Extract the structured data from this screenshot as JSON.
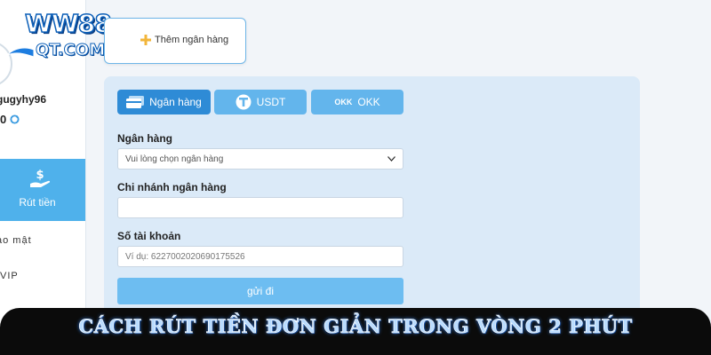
{
  "logo": {
    "line1": "WW88",
    "line2": "QT.COM"
  },
  "user": {
    "username": "gugyhy96",
    "balance": "0"
  },
  "sidebar": {
    "withdraw_label": "Rút tiền",
    "security_label": "ảo mật",
    "vip_label": "VIP"
  },
  "add_bank": {
    "label": "Thêm ngân hàng"
  },
  "tabs": [
    {
      "label": "Ngân hàng"
    },
    {
      "label": "USDT"
    },
    {
      "label": "OKK",
      "mark": "OKK"
    }
  ],
  "form": {
    "bank_label": "Ngân hàng",
    "bank_select_value": "Vui lòng chọn ngân hàng",
    "branch_label": "Chi nhánh ngân hàng",
    "branch_value": "",
    "account_label": "Số tài khoản",
    "account_placeholder": "Ví dụ:  6227002020690175526",
    "submit_label": "gửi đi"
  },
  "banner": {
    "text": "CÁCH RÚT TIỀN ĐƠN GIẢN TRONG VÒNG 2 PHÚT"
  },
  "colors": {
    "accent": "#2e8bd6",
    "tab_inactive": "#63b5ec",
    "sidebar_active": "#4fb1eb",
    "panel": "#dbeaf8",
    "banner_bg": "#0b0b0b"
  }
}
